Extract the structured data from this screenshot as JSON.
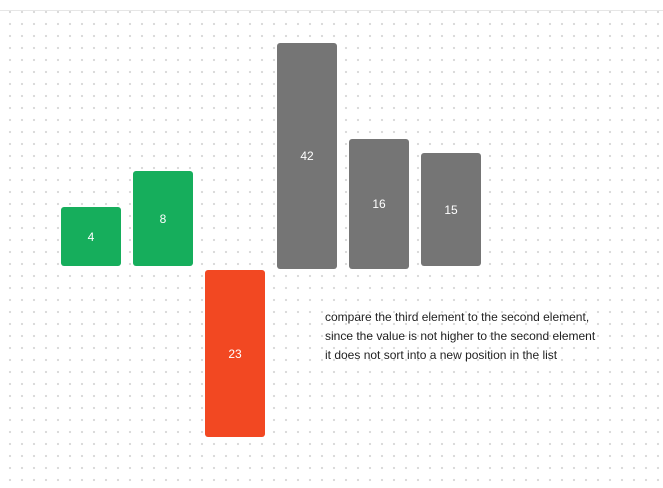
{
  "diagram": {
    "type": "insertion-sort-step",
    "colors": {
      "sorted": "#16ae5c",
      "current": "#f24822",
      "unsorted": "#757575"
    },
    "elements": [
      {
        "value": "4",
        "state": "sorted"
      },
      {
        "value": "8",
        "state": "sorted"
      },
      {
        "value": "23",
        "state": "current"
      },
      {
        "value": "42",
        "state": "unsorted"
      },
      {
        "value": "16",
        "state": "unsorted"
      },
      {
        "value": "15",
        "state": "unsorted"
      }
    ]
  },
  "caption": {
    "lines": [
      "compare the third element to the second element,",
      "since the value is not higher to the second element",
      "it does not sort into a new position in the list"
    ]
  }
}
